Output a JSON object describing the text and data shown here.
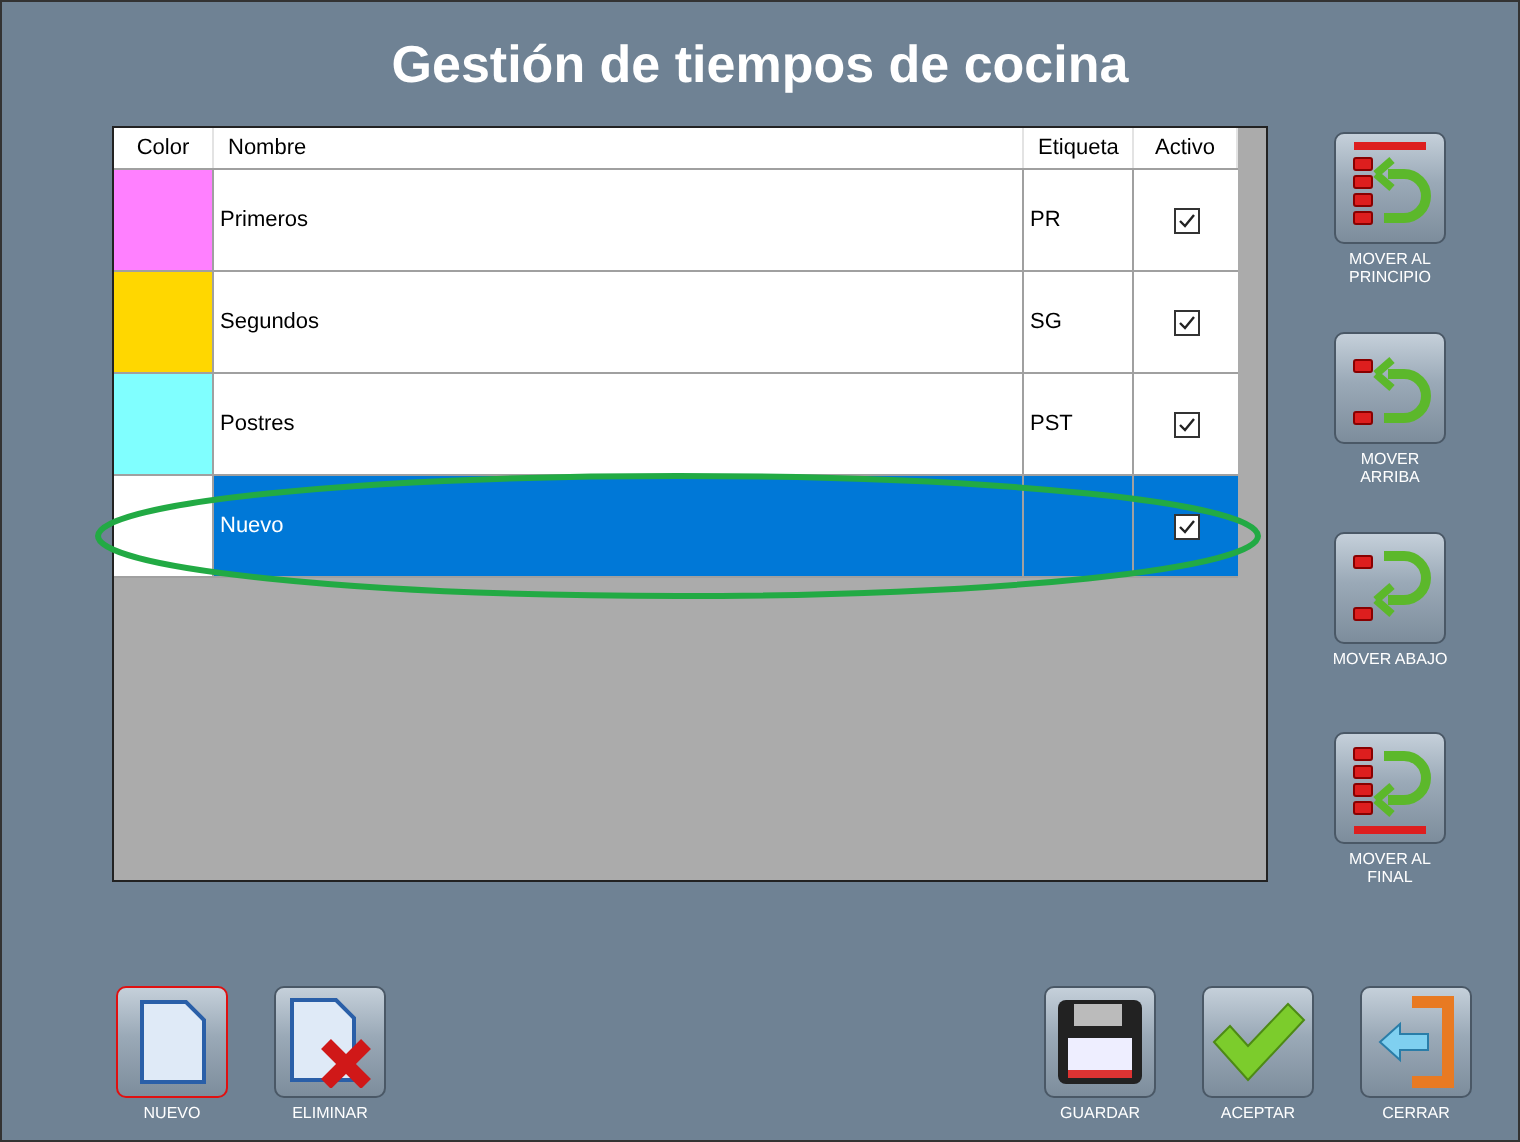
{
  "window": {
    "title": "Gestión de tiempos de cocina"
  },
  "table": {
    "columns": [
      "Color",
      "Nombre",
      "Etiqueta",
      "Activo"
    ],
    "rows": [
      {
        "color": "#ff80ff",
        "name": "Primeros",
        "tag": "PR",
        "active": true,
        "selected": false
      },
      {
        "color": "#ffd700",
        "name": "Segundos",
        "tag": "SG",
        "active": true,
        "selected": false
      },
      {
        "color": "#80ffff",
        "name": "Postres",
        "tag": "PST",
        "active": true,
        "selected": false
      },
      {
        "color": "#ffffff",
        "name": "Nuevo",
        "tag": "",
        "active": true,
        "selected": true
      }
    ]
  },
  "side_buttons": [
    {
      "kind": "top",
      "label": "MOVER AL PRINCIPIO"
    },
    {
      "kind": "up",
      "label": "MOVER ARRIBA"
    },
    {
      "kind": "down",
      "label": "MOVER ABAJO"
    },
    {
      "kind": "bottom",
      "label": "MOVER AL FINAL"
    }
  ],
  "left_buttons": [
    {
      "kind": "new",
      "label": "NUEVO",
      "focused": true
    },
    {
      "kind": "delete",
      "label": "ELIMINAR",
      "focused": false
    }
  ],
  "right_buttons": [
    {
      "kind": "save",
      "label": "GUARDAR",
      "focused": false
    },
    {
      "kind": "accept",
      "label": "ACEPTAR",
      "focused": false
    },
    {
      "kind": "close",
      "label": "CERRAR",
      "focused": false
    }
  ]
}
